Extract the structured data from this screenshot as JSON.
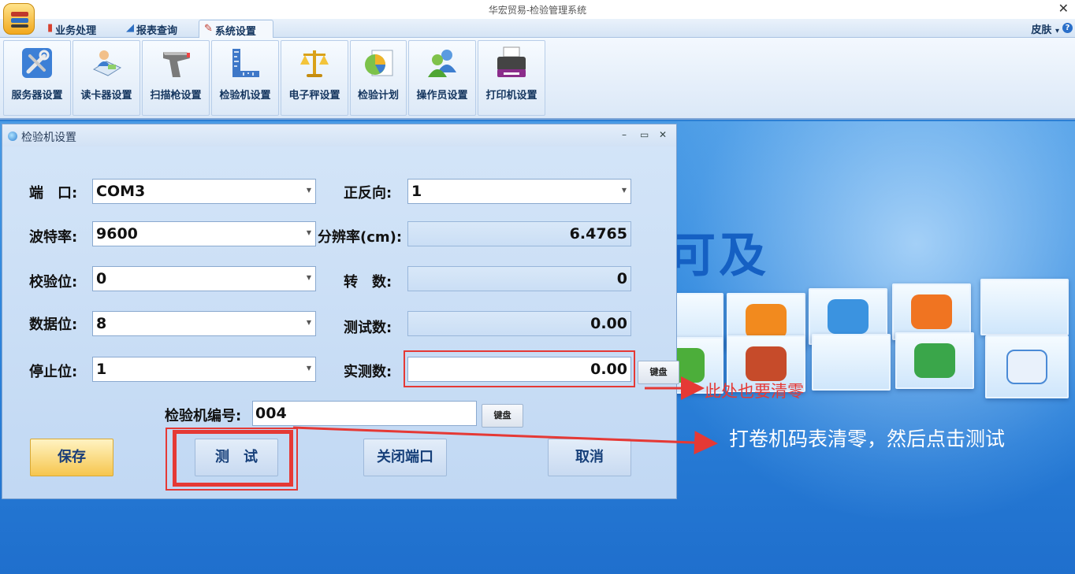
{
  "window": {
    "title": "华宏贸易-检验管理系统",
    "close_glyph": "✕"
  },
  "ribbon_tabs": [
    {
      "label": "业务处理",
      "icon": "bar-chart-icon"
    },
    {
      "label": "报表查询",
      "icon": "area-chart-icon"
    },
    {
      "label": "系统设置",
      "icon": "tools-icon"
    }
  ],
  "skin_menu": {
    "label": "皮肤",
    "arrow": "▾"
  },
  "help_glyph": "?",
  "ribbon_buttons": [
    {
      "label": "服务器设置",
      "icon": "wrench-screwdriver-icon"
    },
    {
      "label": "读卡器设置",
      "icon": "card-reader-icon"
    },
    {
      "label": "扫描枪设置",
      "icon": "barcode-scanner-icon"
    },
    {
      "label": "检验机设置",
      "icon": "ruler-square-icon"
    },
    {
      "label": "电子秤设置",
      "icon": "scale-icon"
    },
    {
      "label": "检验计划",
      "icon": "pie-chart-icon"
    },
    {
      "label": "操作员设置",
      "icon": "users-icon"
    },
    {
      "label": "打印机设置",
      "icon": "printer-icon"
    }
  ],
  "background": {
    "brand_text": "可及"
  },
  "dialog": {
    "title": "检验机设置",
    "controls": {
      "minimize": "–",
      "maximize": "▭",
      "close": "✕"
    },
    "port": {
      "label": "端　口:",
      "value": "COM3"
    },
    "baud": {
      "label": "波特率:",
      "value": "9600"
    },
    "parity": {
      "label": "校验位:",
      "value": "0"
    },
    "databits": {
      "label": "数据位:",
      "value": "8"
    },
    "stopbits": {
      "label": "停止位:",
      "value": "1"
    },
    "direction": {
      "label": "正反向:",
      "value": "1"
    },
    "resolution": {
      "label": "分辨率(cm):",
      "value": "6.4765"
    },
    "revolutions": {
      "label": "转　数:",
      "value": "0"
    },
    "test_count": {
      "label": "测试数:",
      "value": "0.00"
    },
    "actual_count": {
      "label": "实测数:",
      "value": "0.00",
      "keyboard": "键盘"
    },
    "machine_no": {
      "label": "检验机编号:",
      "value": "004",
      "keyboard": "键盘"
    },
    "buttons": {
      "save": "保存",
      "test": "测　试",
      "close_port": "关闭端口",
      "cancel": "取消"
    }
  },
  "annotations": {
    "note1": "此处也要清零",
    "note2": "打卷机码表清零，然后点击测试",
    "color": "#e53935"
  }
}
